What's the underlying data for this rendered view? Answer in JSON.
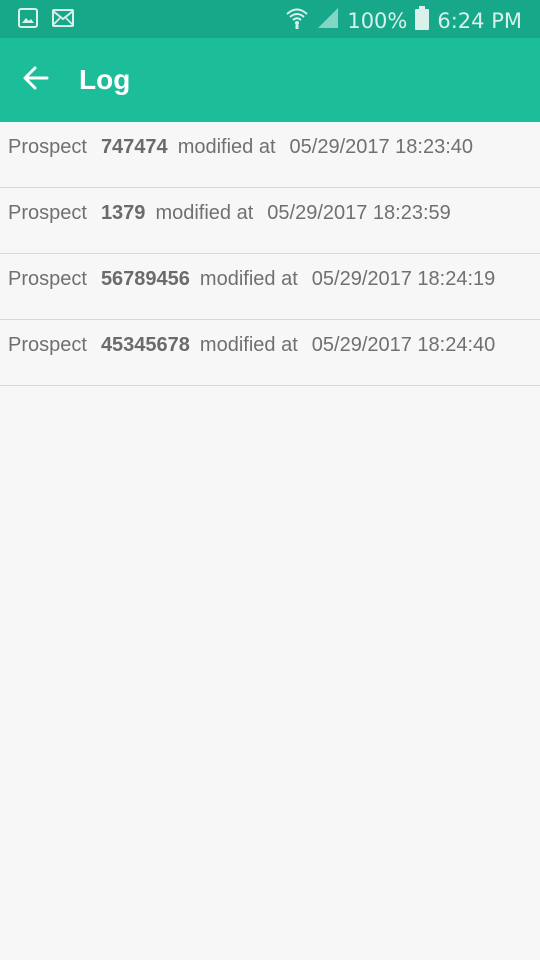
{
  "status_bar": {
    "icons_left": [
      "image-icon",
      "mail-icon"
    ],
    "icons_right": [
      "wifi-icon",
      "signal-icon",
      "battery-icon"
    ],
    "battery_text": "100%",
    "time": "6:24 PM"
  },
  "app_bar": {
    "back_icon": "back-arrow-icon",
    "title": "Log"
  },
  "log": {
    "entries": [
      {
        "prefix": "Prospect",
        "id": "747474",
        "middle": "modified at",
        "timestamp": "05/29/2017 18:23:40"
      },
      {
        "prefix": "Prospect",
        "id": "1379",
        "middle": "modified at",
        "timestamp": "05/29/2017 18:23:59"
      },
      {
        "prefix": "Prospect",
        "id": "56789456",
        "middle": "modified at",
        "timestamp": "05/29/2017 18:24:19"
      },
      {
        "prefix": "Prospect",
        "id": "45345678",
        "middle": "modified at",
        "timestamp": "05/29/2017 18:24:40"
      }
    ]
  },
  "colors": {
    "status_bar": "#17a88a",
    "app_bar": "#1cbe9a",
    "background": "#f7f7f7",
    "text": "#707070"
  }
}
